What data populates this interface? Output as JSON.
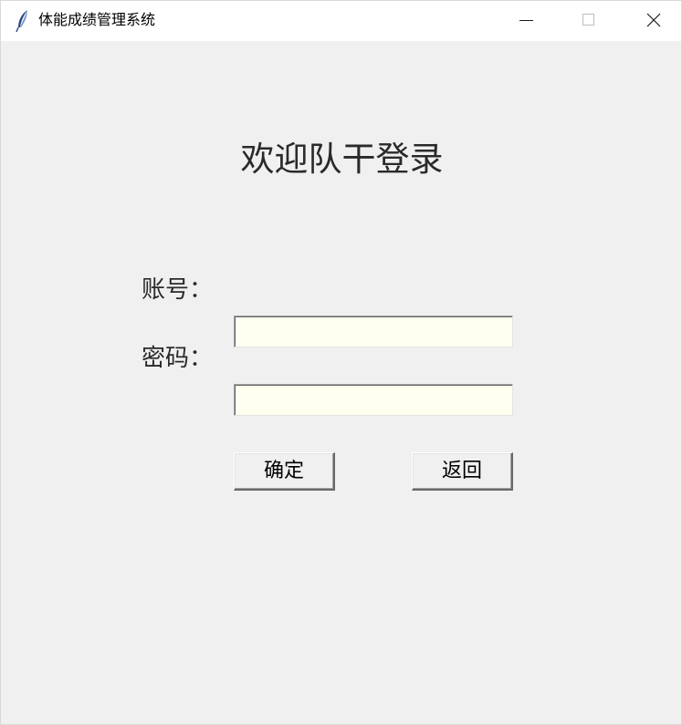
{
  "window": {
    "title": "体能成绩管理系统",
    "icon": "tk-feather-icon",
    "controls": [
      "minimize-icon",
      "maximize-icon",
      "close-icon"
    ]
  },
  "login": {
    "heading": "欢迎队干登录",
    "account_label": "账号：",
    "account_value": "",
    "password_label": "密码：",
    "password_value": "",
    "confirm_label": "确定",
    "back_label": "返回"
  },
  "colors": {
    "window_bg": "#f0f0f0",
    "titlebar_bg": "#ffffff",
    "input_bg": "#fffff0",
    "text": "#2a2a2a"
  }
}
